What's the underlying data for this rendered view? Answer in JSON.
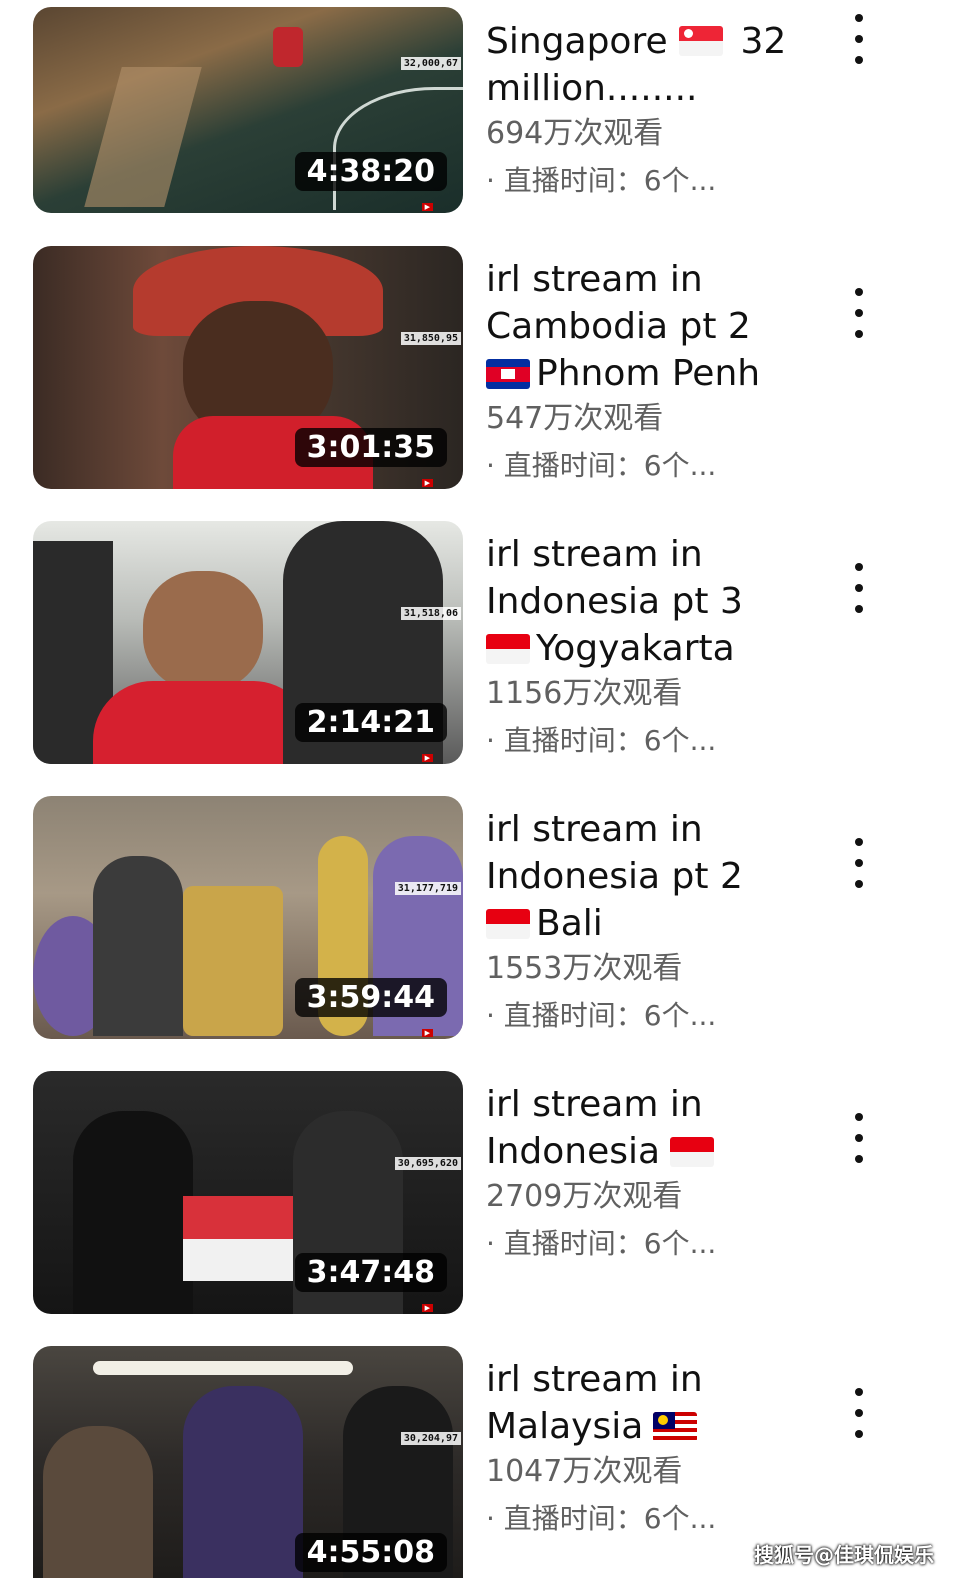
{
  "videos": [
    {
      "title_lines": [
        "Singapore ",
        "million........"
      ],
      "title_suffix": "32",
      "flag": "singapore",
      "views": "694万次观看",
      "meta": "· 直播时间：6个...",
      "duration": "4:38:20",
      "counter": "32,000,67",
      "thumb_colors": [
        "#6b5a43",
        "#1f3b33",
        "#b79a6f"
      ]
    },
    {
      "title_lines": [
        "irl stream in",
        "Cambodia pt 2",
        "Phnom Penh"
      ],
      "flag": "cambodia",
      "views": "547万次观看",
      "meta": "· 直播时间：6个...",
      "duration": "3:01:35",
      "counter": "31,850,95",
      "thumb_colors": [
        "#3a2a22",
        "#c4202c",
        "#6e4a3a"
      ]
    },
    {
      "title_lines": [
        "irl stream in",
        "Indonesia pt 3",
        "Yogyakarta"
      ],
      "flag": "indonesia",
      "views": "1156万次观看",
      "meta": "· 直播时间：6个...",
      "duration": "2:14:21",
      "counter": "31,518,06",
      "thumb_colors": [
        "#cfd3cf",
        "#d6202f",
        "#2b2b2b"
      ]
    },
    {
      "title_lines": [
        "irl stream in",
        "Indonesia pt 2",
        "Bali"
      ],
      "flag": "indonesia",
      "views": "1553万次观看",
      "meta": "· 直播时间：6个...",
      "duration": "3:59:44",
      "counter": "31,177,719",
      "thumb_colors": [
        "#7b6a8f",
        "#c9a54a",
        "#6f5aa0"
      ]
    },
    {
      "title_lines": [
        "irl stream in",
        "Indonesia"
      ],
      "flag": "indonesia",
      "views": "2709万次观看",
      "meta": "· 直播时间：6个...",
      "duration": "3:47:48",
      "counter": "30,695,620",
      "thumb_colors": [
        "#1c1c1c",
        "#d23a3a",
        "#3a3a3a"
      ]
    },
    {
      "title_lines": [
        "irl stream in",
        "Malaysia"
      ],
      "flag": "malaysia",
      "views": "1047万次观看",
      "meta": "· 直播时间：6个...",
      "duration": "4:55:08",
      "counter": "30,204,97",
      "thumb_colors": [
        "#2d2a28",
        "#e7e4dc",
        "#5a4a3c"
      ]
    }
  ],
  "watermark": "搜狐号@佳琪侃娱乐",
  "icons": {
    "more": "more-vert-icon"
  }
}
